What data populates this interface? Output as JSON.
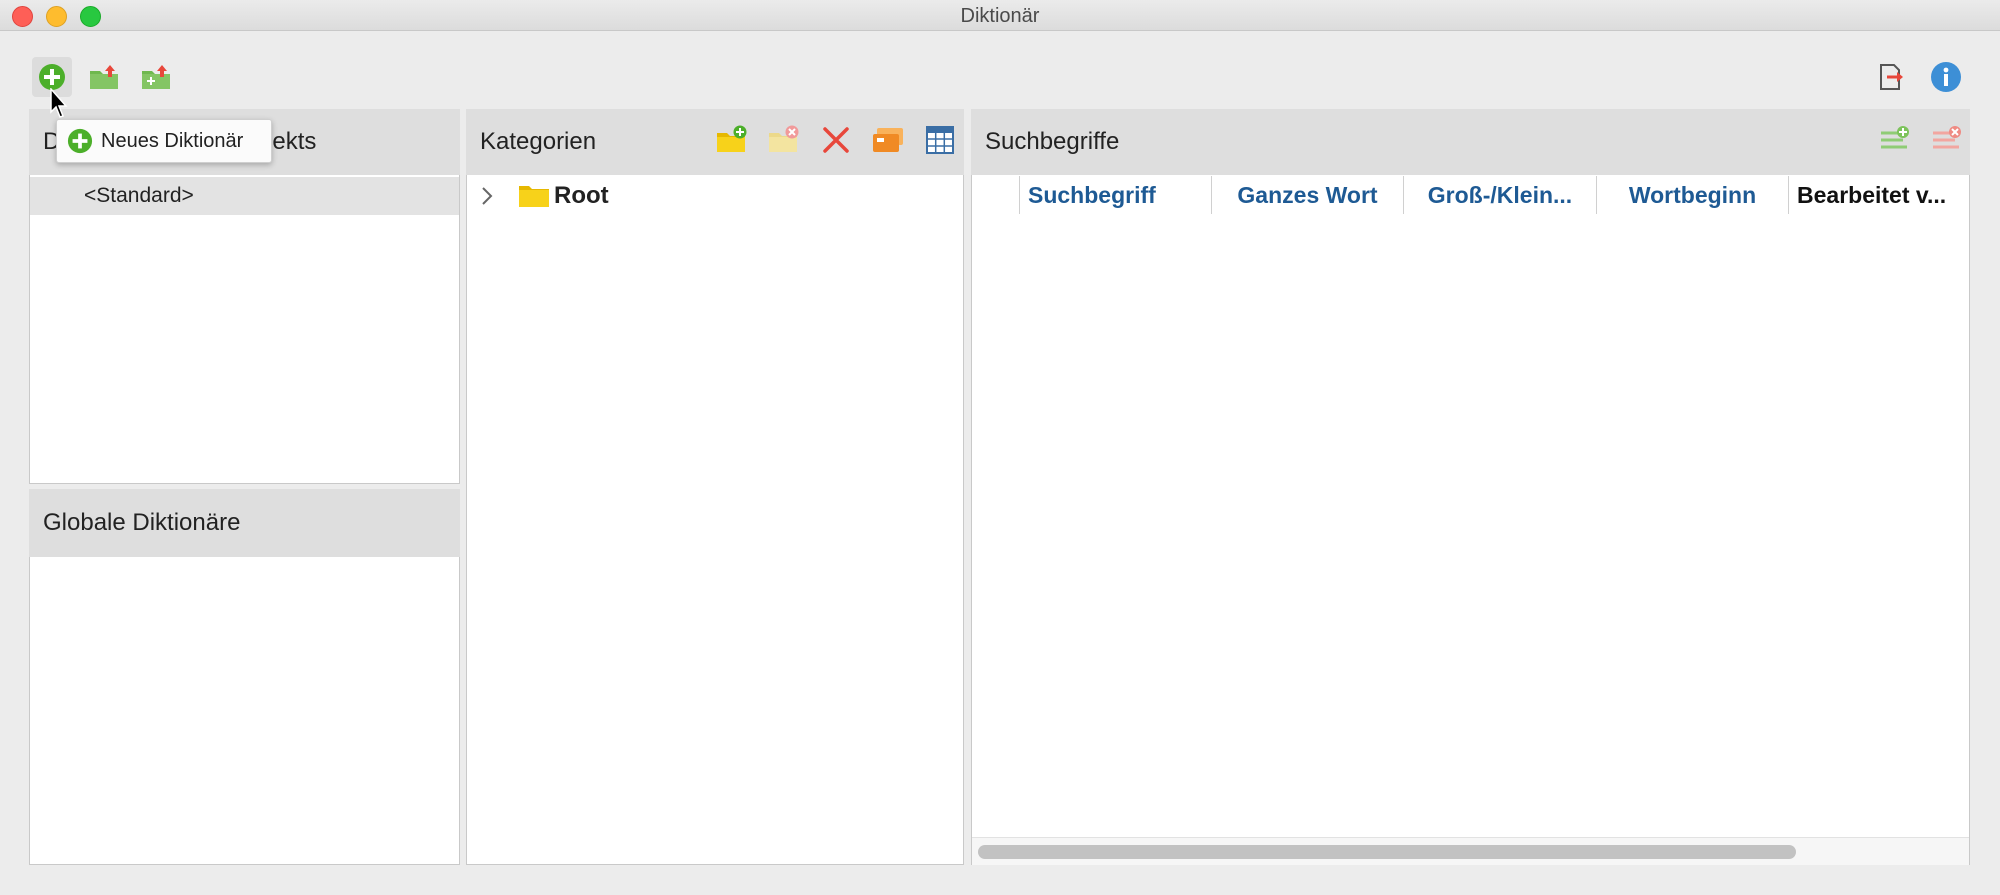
{
  "window": {
    "title": "Diktionär"
  },
  "toolbar": {
    "new_icon": "plus-circle-icon",
    "import_icon": "folder-export-icon",
    "import_add_icon": "folder-add-export-icon",
    "exit_icon": "exit-icon",
    "info_icon": "info-icon"
  },
  "tooltip": {
    "label": "Neues Diktionär"
  },
  "project_panel": {
    "header_visible_start": "D",
    "header_visible_end": "ekts",
    "selected_item": "<Standard>"
  },
  "global_panel": {
    "header": "Globale Diktionäre"
  },
  "categories_panel": {
    "header": "Kategorien",
    "tree": [
      {
        "label": "Root",
        "expanded": false
      }
    ]
  },
  "search_panel": {
    "header": "Suchbegriffe",
    "columns": [
      "Suchbegriff",
      "Ganzes Wort",
      "Groß-/Klein...",
      "Wortbeginn",
      "Bearbeitet v..."
    ]
  },
  "colors": {
    "accent_green": "#4caf2a",
    "folder_yellow": "#f7d21a",
    "column_blue": "#1e5a94",
    "delete_red": "#e8473b"
  }
}
